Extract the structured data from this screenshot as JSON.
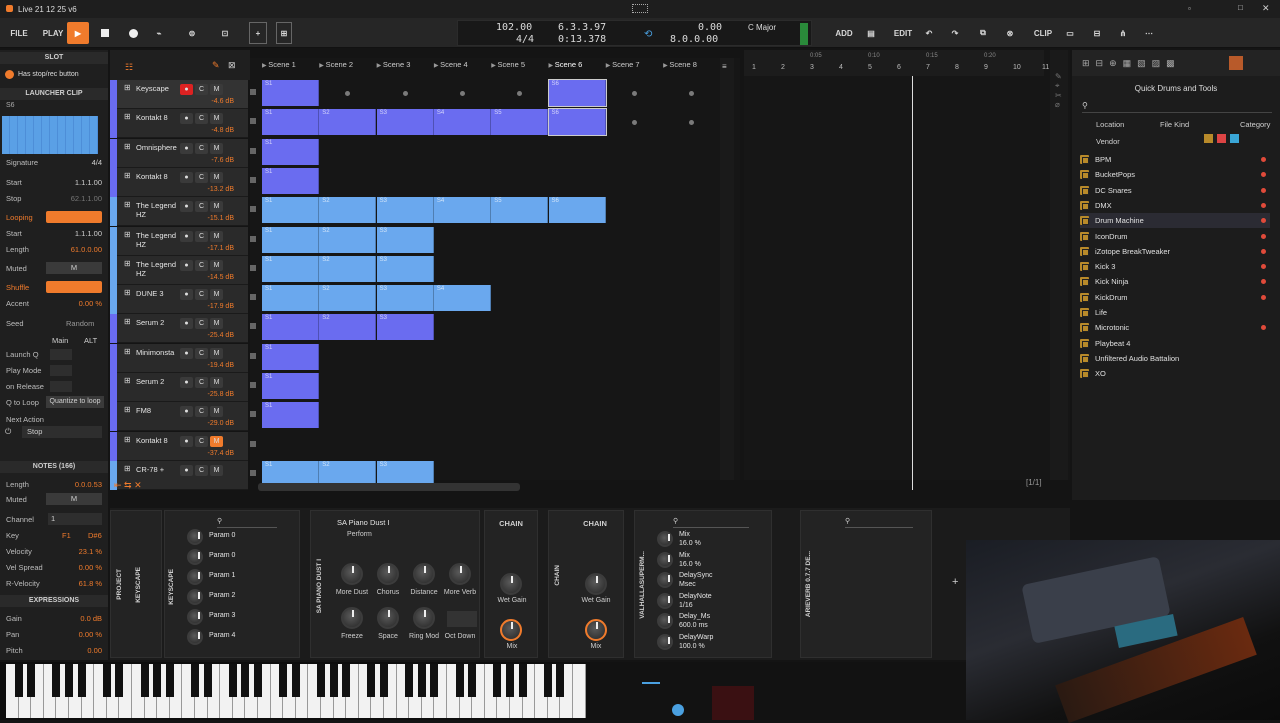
{
  "app": {
    "title": "Live 21 12 25 v6",
    "colors": {
      "accent": "#f07b2c",
      "launcher": "#6a6cf0",
      "clip_blue": "#6aa8ee"
    }
  },
  "toolbar": {
    "file": "FILE",
    "play": "PLAY",
    "add": "ADD",
    "edit": "EDIT",
    "chain": "CLIP",
    "tempo": "102.00",
    "sig": "4/4",
    "pos": "6.3.3.97",
    "time": "0:13.378",
    "loop1": "0.00",
    "loop2": "8.0.0.00",
    "key": "C Major"
  },
  "inspector": {
    "slot_title": "SLOT",
    "hint": "Has stop/rec button",
    "launcher_clip": "LAUNCHER CLIP",
    "clip_name": "S6",
    "signature_label": "Signature",
    "signature": "4/4",
    "start_label": "Start",
    "start": "1.1.1.00",
    "stop_label": "Stop",
    "stop": "62.1.1.00",
    "looping_label": "Looping",
    "lstart_label": "Start",
    "lstart": "1.1.1.00",
    "length_label": "Length",
    "length": "61.0.0.00",
    "muted_label": "Muted",
    "m": "M",
    "shuffle_label": "Shuffle",
    "accent_label": "Accent",
    "accent": "0.00 %",
    "seed_label": "Seed",
    "random": "Random",
    "main": "Main",
    "alt": "ALT",
    "launchq": "Launch Q",
    "playmode": "Play Mode",
    "onrelease": "on Release",
    "qtoloop": "Q to Loop",
    "quant": "Quantize to loop",
    "nextaction": "Next Action",
    "stop_val": "Stop",
    "notes_title": "NOTES (166)",
    "nlength_label": "Length",
    "nlength": "0.0.0.53",
    "nmuted_label": "Muted",
    "channel_label": "Channel",
    "channel": "1",
    "key_label": "Key",
    "key1": "F1",
    "key2": "D#6",
    "velocity_label": "Velocity",
    "velocity": "23.1 %",
    "velspread_label": "Vel Spread",
    "velspread": "0.00 %",
    "rvel_label": "R-Velocity",
    "rvel": "61.8 %",
    "expr_title": "EXPRESSIONS",
    "gain_label": "Gain",
    "gain": "0.0 dB",
    "pan_label": "Pan",
    "pan": "0.00 %",
    "pitch_label": "Pitch",
    "pitch": "0.00"
  },
  "scenes": [
    "Scene 1",
    "Scene 2",
    "Scene 3",
    "Scene 4",
    "Scene 5",
    "Scene 6",
    "Scene 7",
    "Scene 8"
  ],
  "tracks": [
    {
      "name": "Keyscape",
      "level": "-4.6 dB",
      "color": "#6a6cf0"
    },
    {
      "name": "Kontakt 8",
      "level": "-4.8 dB",
      "color": "#6a6cf0"
    },
    {
      "name": "Omnisphere",
      "level": "-7.6 dB",
      "color": "#6a6cf0"
    },
    {
      "name": "Kontakt 8",
      "level": "-13.2 dB",
      "color": "#6a6cf0"
    },
    {
      "name": "The Legend HZ",
      "level": "-15.1 dB",
      "color": "#6aa8ee"
    },
    {
      "name": "The Legend HZ",
      "level": "-17.1 dB",
      "color": "#6aa8ee"
    },
    {
      "name": "The Legend HZ",
      "level": "-14.5 dB",
      "color": "#6aa8ee"
    },
    {
      "name": "DUNE 3",
      "level": "-17.9 dB",
      "color": "#6aa8ee"
    },
    {
      "name": "Serum 2",
      "level": "-25.4 dB",
      "color": "#6a6cf0"
    },
    {
      "name": "Minimonsta",
      "level": "-19.4 dB",
      "color": "#6a6cf0"
    },
    {
      "name": "Serum 2",
      "level": "-25.8 dB",
      "color": "#6a6cf0"
    },
    {
      "name": "FM8",
      "level": "-29.0 dB",
      "color": "#6a6cf0"
    },
    {
      "name": "Kontakt 8",
      "level": "-37.4 dB",
      "color": "#6a6cf0"
    },
    {
      "name": "CR-78 +",
      "level": "",
      "color": "#6aa8ee"
    }
  ],
  "track_buttons": {
    "c": "C",
    "m": "M"
  },
  "arranger": {
    "ruler": [
      "1",
      "2",
      "3",
      "4",
      "5",
      "6",
      "7",
      "8",
      "9",
      "10",
      "11"
    ],
    "sub": [
      "0:05",
      "0:10",
      "0:15",
      "0:20"
    ],
    "page": "[1/1]"
  },
  "browser": {
    "title": "Quick Drums and Tools",
    "location": "Location",
    "filekind": "File Kind",
    "category": "Category",
    "vendor": "Vendor",
    "items": [
      "BPM",
      "BucketPops",
      "DC Snares",
      "DMX",
      "Drum Machine",
      "IconDrum",
      "iZotope BreakTweaker",
      "Kick 3",
      "Kick Ninja",
      "KickDrum",
      "Life",
      "Microtonic",
      "Playbeat 4",
      "Unfiltered Audio Battalion",
      "XO"
    ]
  },
  "devices": {
    "project": "PROJECT",
    "keyscape": "KEYSCAPE",
    "keyscape2": "KEYSCAPE",
    "params": [
      "Param 0",
      "Param 0",
      "Param 1",
      "Param 2",
      "Param 3",
      "Param 4"
    ],
    "sapiano": "SA Piano Dust I",
    "perform": "Perform",
    "sapiano_v": "SA PIANO DUST I",
    "knobs": [
      "More Dust",
      "Chorus",
      "Distance",
      "More Verb",
      "Freeze",
      "Space",
      "Ring Mod",
      "Oct Down"
    ],
    "chain1": "CHAIN",
    "wetgain": "Wet Gain",
    "mix": "Mix",
    "chain_v": "CHAIN",
    "chain2": "CHAIN",
    "valhalla_v": "VALHALLASUPERM...",
    "valhalla": [
      {
        "n": "Mix",
        "v": "16.0 %"
      },
      {
        "n": "Mix",
        "v": "16.0 %"
      },
      {
        "n": "DelaySync",
        "v": "Msec"
      },
      {
        "n": "DelayNote",
        "v": "1/16"
      },
      {
        "n": "Delay_Ms",
        "v": "600.0 ms"
      },
      {
        "n": "DelayWarp",
        "v": "100.0 %"
      }
    ],
    "arieverb_v": "ARIEVERB 0.7.7 DE..."
  }
}
